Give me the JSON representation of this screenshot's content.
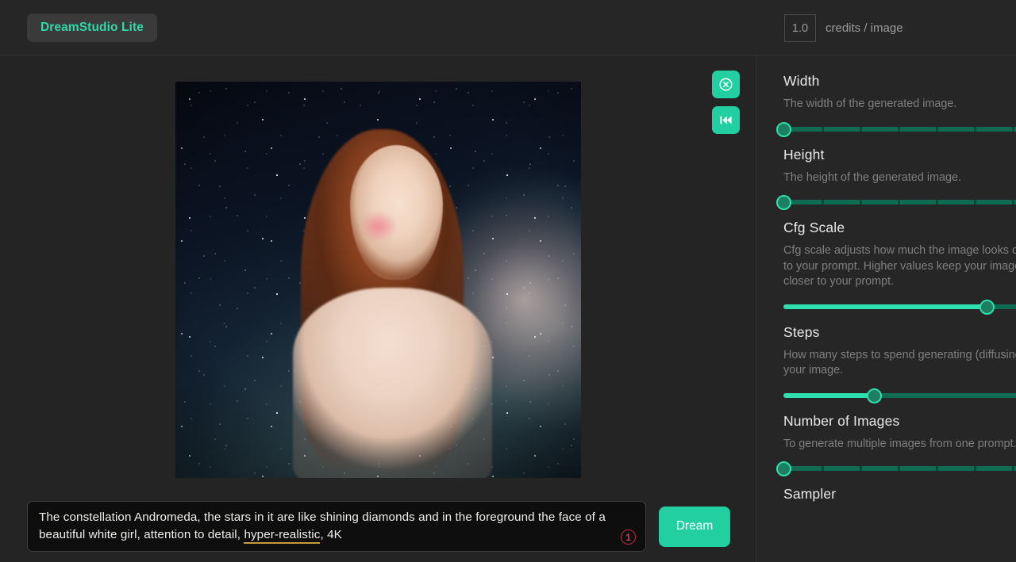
{
  "header": {
    "logo_label": "DreamStudio Lite",
    "credits_value": "1.0",
    "credits_label": "credits / image"
  },
  "canvas": {
    "actions": [
      {
        "name": "cancel-button",
        "icon": "circle-x-icon"
      },
      {
        "name": "reset-button",
        "icon": "skip-back-icon"
      }
    ]
  },
  "prompt": {
    "part1": "The constellation Andromeda, the stars in it are like shining diamonds and in the foreground the face of a beautiful white girl, attention to detail, ",
    "misspelled": "hyper-realistic",
    "part2": ", 4K",
    "badge": "1",
    "dream_label": "Dream"
  },
  "settings": [
    {
      "title": "Width",
      "description": "The width of the generated image.",
      "slider": {
        "fill_percent": 0,
        "handle_percent": 0
      }
    },
    {
      "title": "Height",
      "description": "The height of the generated image.",
      "slider": {
        "fill_percent": 0,
        "handle_percent": 0
      }
    },
    {
      "title": "Cfg Scale",
      "description": "Cfg scale adjusts how much the image looks closer to your prompt. Higher values keep your image closer to your prompt.",
      "slider": {
        "fill_percent": 83,
        "handle_percent": 83
      }
    },
    {
      "title": "Steps",
      "description": "How many steps to spend generating (diffusing) your image.",
      "slider": {
        "fill_percent": 37,
        "handle_percent": 37
      }
    },
    {
      "title": "Number of Images",
      "description": "To generate multiple images from one prompt.",
      "slider": {
        "fill_percent": 0,
        "handle_percent": 0
      }
    },
    {
      "title": "Sampler",
      "description": "",
      "slider": null
    }
  ],
  "colors": {
    "accent": "#22cfa0",
    "background": "#242424",
    "panel": "#262626",
    "badge": "#d83a5e",
    "spellcheck": "#c79a3c"
  }
}
